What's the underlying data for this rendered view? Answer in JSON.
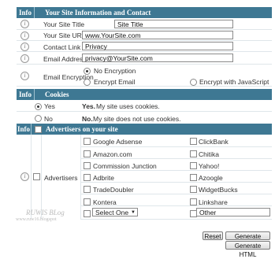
{
  "info_header": {
    "info": "Info",
    "title": "Your Site Information and Contact"
  },
  "fields": [
    {
      "label": "Your Site Title",
      "value": "Site Title"
    },
    {
      "label": "Your Site URL",
      "value": "www.YourSite.com"
    },
    {
      "label": "Contact Link",
      "value": "Privacy"
    },
    {
      "label": "Email Address",
      "value": "privacy@YourSite.com"
    }
  ],
  "encryption": {
    "label": "Email Encryption",
    "options": [
      "No Encryption",
      "Encrypt Email",
      "Encrypt with JavaScript"
    ],
    "selected": "No Encryption"
  },
  "cookies_header": {
    "info": "Info",
    "title": "Cookies"
  },
  "cookies": {
    "yes": {
      "label": "Yes",
      "strong": "Yes.",
      "desc": "My site uses cookies."
    },
    "no": {
      "label": "No",
      "strong": "No.",
      "desc": "My site does not use cookies."
    },
    "selected": "Yes"
  },
  "advertisers_header": {
    "info": "Info",
    "title": "Advertisers on your site"
  },
  "advertisers": {
    "label": "Advertisers",
    "left": [
      "Google Adsense",
      "Amazon.com",
      "Commission Junction",
      "Adbrite",
      "TradeDoubler",
      "Kontera"
    ],
    "right": [
      "ClickBank",
      "Chitika",
      "Yahoo!",
      "Azoogle",
      "WidgetBucks",
      "Linkshare"
    ],
    "select_value": "Select One",
    "other_value": "Other"
  },
  "buttons": {
    "reset": "Reset",
    "generate_policy": "Generate Policy",
    "generate_html": "Generate HTML"
  },
  "watermark": {
    "line1": "RUWIS BLog",
    "line2": "www.ruw16.blogspot"
  }
}
